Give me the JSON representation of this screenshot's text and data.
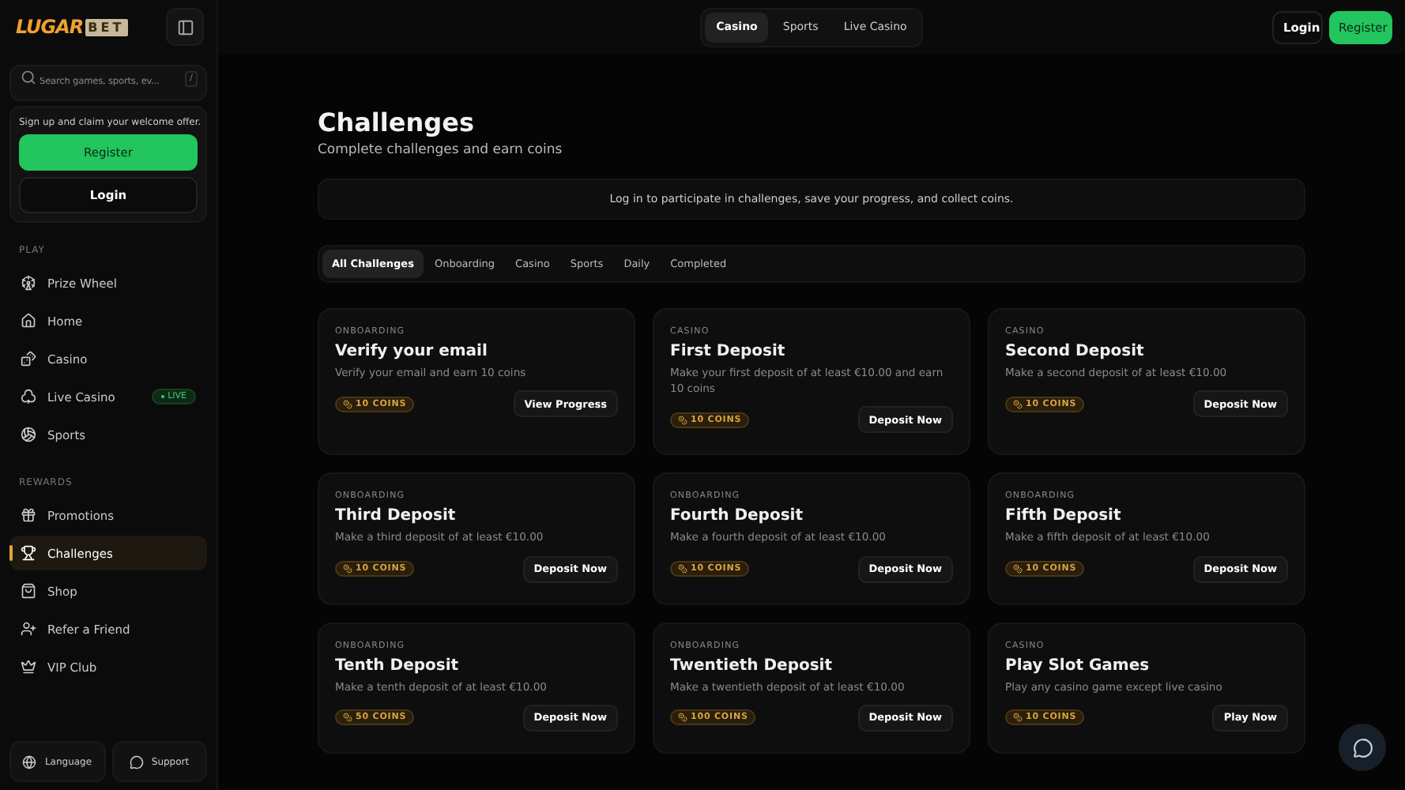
{
  "logo": {
    "word": "LUGAR",
    "boxed": "BET"
  },
  "sidebar": {
    "search": {
      "placeholder": "Search games, sports, ev...",
      "shortcut": "/"
    },
    "welcome": {
      "text": "Sign up and claim your welcome offer.",
      "register": "Register",
      "login": "Login"
    },
    "sections": [
      {
        "title": "PLAY",
        "items": [
          {
            "label": "Prize Wheel",
            "selected": false
          },
          {
            "label": "Home",
            "selected": false
          },
          {
            "label": "Casino",
            "selected": false
          },
          {
            "label": "Live Casino",
            "selected": false,
            "badge": "LIVE"
          },
          {
            "label": "Sports",
            "selected": false
          }
        ]
      },
      {
        "title": "REWARDS",
        "items": [
          {
            "label": "Promotions",
            "selected": false
          },
          {
            "label": "Challenges",
            "selected": true
          },
          {
            "label": "Shop",
            "selected": false
          },
          {
            "label": "Refer a Friend",
            "selected": false
          },
          {
            "label": "VIP Club",
            "selected": false
          }
        ]
      }
    ],
    "footer": [
      "Language",
      "Support"
    ]
  },
  "topbar": {
    "tabs": [
      {
        "label": "Casino",
        "selected": true
      },
      {
        "label": "Sports",
        "selected": false
      },
      {
        "label": "Live Casino",
        "selected": false
      }
    ],
    "login": "Login",
    "register": "Register"
  },
  "page": {
    "title": "Challenges",
    "subtitle": "Complete challenges and earn coins",
    "notice": "Log in to participate in challenges, save your progress, and collect coins.",
    "filters": [
      {
        "label": "All Challenges",
        "selected": true
      },
      {
        "label": "Onboarding",
        "selected": false
      },
      {
        "label": "Casino",
        "selected": false
      },
      {
        "label": "Sports",
        "selected": false
      },
      {
        "label": "Daily",
        "selected": false
      },
      {
        "label": "Completed",
        "selected": false
      }
    ],
    "cards": [
      {
        "category": "ONBOARDING",
        "title": "Verify your email",
        "description": "Verify your email and earn 10 coins",
        "reward": "10 COINS",
        "action": "View Progress"
      },
      {
        "category": "CASINO",
        "title": "First Deposit",
        "description": "Make your first deposit of at least €10.00 and earn 10 coins",
        "reward": "10 COINS",
        "action": "Deposit Now"
      },
      {
        "category": "CASINO",
        "title": "Second Deposit",
        "description": "Make a second deposit of at least €10.00",
        "reward": "10 COINS",
        "action": "Deposit Now"
      },
      {
        "category": "ONBOARDING",
        "title": "Third Deposit",
        "description": "Make a third deposit of at least €10.00",
        "reward": "10 COINS",
        "action": "Deposit Now"
      },
      {
        "category": "ONBOARDING",
        "title": "Fourth Deposit",
        "description": "Make a fourth deposit of at least €10.00",
        "reward": "10 COINS",
        "action": "Deposit Now"
      },
      {
        "category": "ONBOARDING",
        "title": "Fifth Deposit",
        "description": "Make a fifth deposit of at least €10.00",
        "reward": "10 COINS",
        "action": "Deposit Now"
      },
      {
        "category": "ONBOARDING",
        "title": "Tenth Deposit",
        "description": "Make a tenth deposit of at least €10.00",
        "reward": "50 COINS",
        "action": "Deposit Now"
      },
      {
        "category": "ONBOARDING",
        "title": "Twentieth Deposit",
        "description": "Make a twentieth deposit of at least €10.00",
        "reward": "100 COINS",
        "action": "Deposit Now"
      },
      {
        "category": "CASINO",
        "title": "Play Slot Games",
        "description": "Play any casino game except live casino",
        "reward": "10 COINS",
        "action": "Play Now"
      }
    ]
  }
}
